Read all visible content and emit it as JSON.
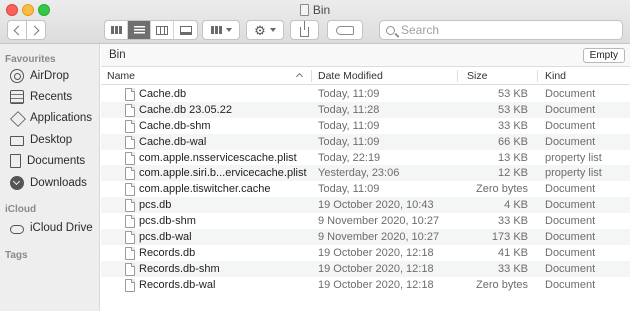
{
  "window": {
    "title": "Bin"
  },
  "toolbar": {
    "search_placeholder": "Search"
  },
  "sidebar": {
    "favourites_heading": "Favourites",
    "favourites": [
      {
        "label": "AirDrop",
        "icon": "airdrop-icon"
      },
      {
        "label": "Recents",
        "icon": "recents-icon"
      },
      {
        "label": "Applications",
        "icon": "applications-icon"
      },
      {
        "label": "Desktop",
        "icon": "desktop-icon"
      },
      {
        "label": "Documents",
        "icon": "documents-icon"
      },
      {
        "label": "Downloads",
        "icon": "downloads-icon"
      }
    ],
    "icloud_heading": "iCloud",
    "icloud": [
      {
        "label": "iCloud Drive",
        "icon": "cloud-icon"
      }
    ],
    "tags_heading": "Tags"
  },
  "pathbar": {
    "title": "Bin",
    "empty_label": "Empty"
  },
  "columns": {
    "name": "Name",
    "date": "Date Modified",
    "size": "Size",
    "kind": "Kind"
  },
  "files": [
    {
      "name": "Cache.db",
      "date": "Today, 11:09",
      "size": "53 KB",
      "kind": "Document"
    },
    {
      "name": "Cache.db 23.05.22",
      "date": "Today, 11:28",
      "size": "53 KB",
      "kind": "Document"
    },
    {
      "name": "Cache.db-shm",
      "date": "Today, 11:09",
      "size": "33 KB",
      "kind": "Document"
    },
    {
      "name": "Cache.db-wal",
      "date": "Today, 11:09",
      "size": "66 KB",
      "kind": "Document"
    },
    {
      "name": "com.apple.nsservicescache.plist",
      "date": "Today, 22:19",
      "size": "13 KB",
      "kind": "property list"
    },
    {
      "name": "com.apple.siri.b...ervicecache.plist",
      "date": "Yesterday, 23:06",
      "size": "12 KB",
      "kind": "property list"
    },
    {
      "name": "com.apple.tiswitcher.cache",
      "date": "Today, 11:09",
      "size": "Zero bytes",
      "kind": "Document"
    },
    {
      "name": "pcs.db",
      "date": "19 October 2020, 10:43",
      "size": "4 KB",
      "kind": "Document"
    },
    {
      "name": "pcs.db-shm",
      "date": "9 November 2020, 10:27",
      "size": "33 KB",
      "kind": "Document"
    },
    {
      "name": "pcs.db-wal",
      "date": "9 November 2020, 10:27",
      "size": "173 KB",
      "kind": "Document"
    },
    {
      "name": "Records.db",
      "date": "19 October 2020, 12:18",
      "size": "41 KB",
      "kind": "Document"
    },
    {
      "name": "Records.db-shm",
      "date": "19 October 2020, 12:18",
      "size": "33 KB",
      "kind": "Document"
    },
    {
      "name": "Records.db-wal",
      "date": "19 October 2020, 12:18",
      "size": "Zero bytes",
      "kind": "Document"
    }
  ]
}
